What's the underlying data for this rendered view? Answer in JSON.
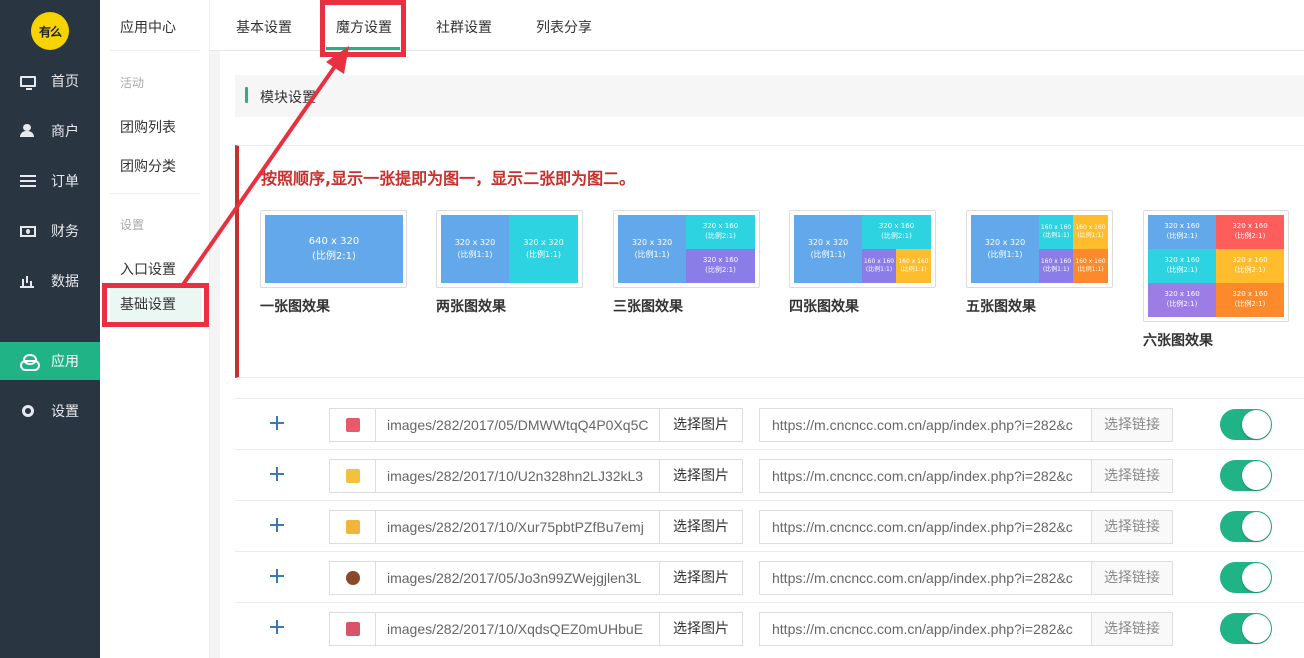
{
  "brand": {
    "logo_text": "有么"
  },
  "sidebar": {
    "items": [
      {
        "label": "首页",
        "icon": "monitor-icon"
      },
      {
        "label": "商户",
        "icon": "users-icon"
      },
      {
        "label": "订单",
        "icon": "list-icon"
      },
      {
        "label": "财务",
        "icon": "money-icon"
      },
      {
        "label": "数据",
        "icon": "bar-chart-icon"
      },
      {
        "label": "应用",
        "icon": "apps-icon",
        "active": true
      },
      {
        "label": "设置",
        "icon": "gear-icon"
      }
    ]
  },
  "subnav": {
    "title": "应用中心",
    "group1": "活动",
    "item1": "团购列表",
    "item2": "团购分类",
    "group2": "设置",
    "item3": "入口设置",
    "item4": "基础设置"
  },
  "tabs": [
    {
      "label": "基本设置"
    },
    {
      "label": "魔方设置",
      "active": true
    },
    {
      "label": "社群设置"
    },
    {
      "label": "列表分享"
    }
  ],
  "module": {
    "header": "模块设置"
  },
  "notice": {
    "message": "按照顺序,显示一张提即为图一，显示二张即为图二。"
  },
  "examples": {
    "one": {
      "caption": "一张图效果",
      "cells": [
        [
          "640 x 320",
          "(比例2:1)"
        ]
      ]
    },
    "two": {
      "caption": "两张图效果",
      "cells": [
        [
          "320 x 320",
          "(比例1:1)"
        ],
        [
          "320 x 320",
          "(比例1:1)"
        ]
      ]
    },
    "three": {
      "caption": "三张图效果",
      "cells": [
        [
          "320 x 320",
          "(比例1:1)"
        ],
        [
          "320 x 160",
          "(比例2:1)"
        ],
        [
          "320 x 160",
          "(比例2:1)"
        ]
      ]
    },
    "four": {
      "caption": "四张图效果",
      "cells": [
        [
          "320 x 320",
          "(比例1:1)"
        ],
        [
          "320 x 160",
          "(比例2:1)"
        ],
        [
          "160 x 160",
          "(比例1:1)"
        ],
        [
          "160 x 160",
          "(比例1:1)"
        ]
      ]
    },
    "five": {
      "caption": "五张图效果",
      "cells": [
        [
          "320 x 320",
          "(比例1:1)"
        ],
        [
          "160 x 160",
          "(比例1:1)"
        ],
        [
          "160 x 160",
          "(比例1:1)"
        ],
        [
          "160 x 160",
          "(比例1:1)"
        ],
        [
          "160 x 160",
          "(比例1:1)"
        ]
      ]
    },
    "six": {
      "caption": "六张图效果",
      "cells": [
        [
          "320 x 160",
          "(比例2:1)"
        ],
        [
          "320 x 160",
          "(比例2:1)"
        ],
        [
          "320 x 160",
          "(比例2:1)"
        ],
        [
          "320 x 160",
          "(比例2:1)"
        ],
        [
          "320 x 160",
          "(比例2:1)"
        ],
        [
          "320 x 160",
          "(比例2:1)"
        ]
      ]
    }
  },
  "rows": [
    {
      "image": "images/282/2017/05/DMWWtqQ4P0Xq5C",
      "pick_image": "选择图片",
      "link": "https://m.cncncc.com.cn/app/index.php?i=282&c",
      "pick_link": "选择链接",
      "enabled": true
    },
    {
      "image": "images/282/2017/10/U2n328hn2LJ32kL3",
      "pick_image": "选择图片",
      "link": "https://m.cncncc.com.cn/app/index.php?i=282&c",
      "pick_link": "选择链接",
      "enabled": true
    },
    {
      "image": "images/282/2017/10/Xur75pbtPZfBu7emj",
      "pick_image": "选择图片",
      "link": "https://m.cncncc.com.cn/app/index.php?i=282&c",
      "pick_link": "选择链接",
      "enabled": true
    },
    {
      "image": "images/282/2017/05/Jo3n99ZWejgjlen3L",
      "pick_image": "选择图片",
      "link": "https://m.cncncc.com.cn/app/index.php?i=282&c",
      "pick_link": "选择链接",
      "enabled": true
    },
    {
      "image": "images/282/2017/10/XqdsQEZ0mUHbuE",
      "pick_image": "选择图片",
      "link": "https://m.cncncc.com.cn/app/index.php?i=282&c",
      "pick_link": "选择链接",
      "enabled": true
    }
  ],
  "colors": {
    "accent": "#1fb385",
    "sidebar_bg": "#2a3542",
    "annotation": "#e93040",
    "notice": "#c9302c"
  }
}
